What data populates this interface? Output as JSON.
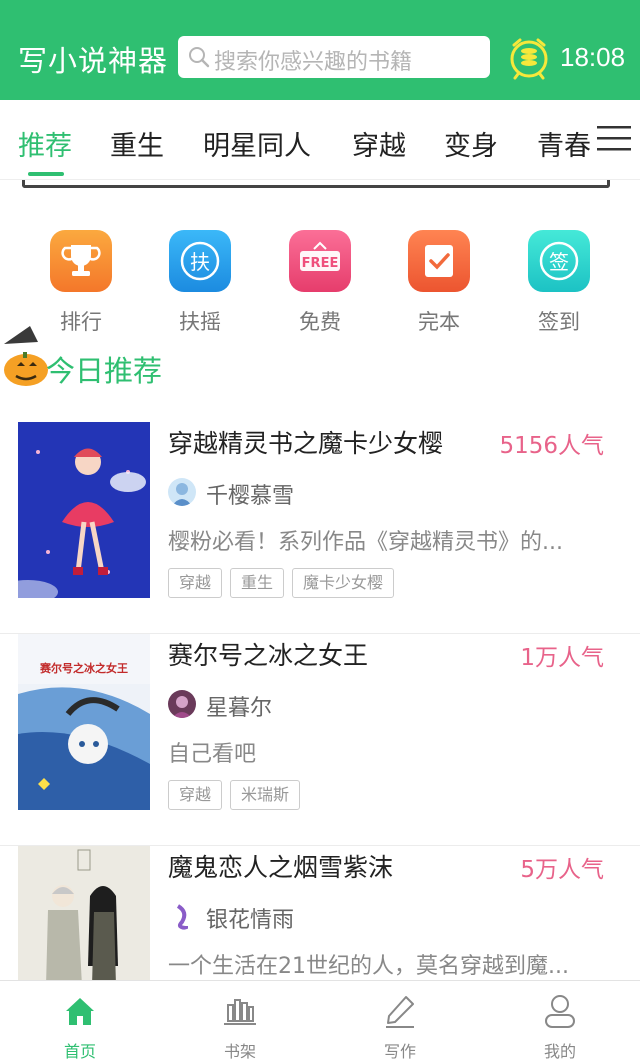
{
  "header": {
    "app_title": "写小说神器",
    "search_placeholder": "搜索你感兴趣的书籍",
    "clock": "18:08",
    "accent_color": "#2fbf71",
    "coin_icon": "alarm-coin-icon"
  },
  "tabs": [
    {
      "label": "推荐",
      "active": true
    },
    {
      "label": "重生",
      "active": false
    },
    {
      "label": "明星同人",
      "active": false
    },
    {
      "label": "穿越",
      "active": false
    },
    {
      "label": "变身",
      "active": false
    },
    {
      "label": "青春",
      "active": false
    }
  ],
  "quick_links": [
    {
      "label": "排行",
      "icon": "trophy-icon",
      "color": "#f7932f"
    },
    {
      "label": "扶摇",
      "icon": "fuyao-icon",
      "color": "#2aa4f0",
      "glyph": "扶"
    },
    {
      "label": "免费",
      "icon": "free-icon",
      "color": "#ef4f7c",
      "glyph": "FREE"
    },
    {
      "label": "完本",
      "icon": "complete-icon",
      "color": "#f26a3c"
    },
    {
      "label": "签到",
      "icon": "signin-icon",
      "color": "#2ed3c8",
      "glyph": "签"
    }
  ],
  "section": {
    "title": "今日推荐"
  },
  "books": [
    {
      "title": "穿越精灵书之魔卡少女樱",
      "popularity": "5156人气",
      "author": "千樱慕雪",
      "description": "樱粉必看！系列作品《穿越精灵书》的...",
      "tags": [
        "穿越",
        "重生",
        "魔卡少女樱"
      ]
    },
    {
      "title": "赛尔号之冰之女王",
      "popularity": "1万人气",
      "author": "星暮尔",
      "description": "自己看吧",
      "tags": [
        "穿越",
        "米瑞斯"
      ],
      "cover_text": "赛尔号之冰之女王"
    },
    {
      "title": "魔鬼恋人之烟雪紫沫",
      "popularity": "5万人气",
      "author": "银花情雨",
      "description": "一个生活在21世纪的人，莫名穿越到魔...",
      "tags": []
    }
  ],
  "bottom_nav": [
    {
      "label": "首页",
      "icon": "home-icon",
      "active": true
    },
    {
      "label": "书架",
      "icon": "bookshelf-icon",
      "active": false
    },
    {
      "label": "写作",
      "icon": "pencil-icon",
      "active": false
    },
    {
      "label": "我的",
      "icon": "user-icon",
      "active": false
    }
  ]
}
